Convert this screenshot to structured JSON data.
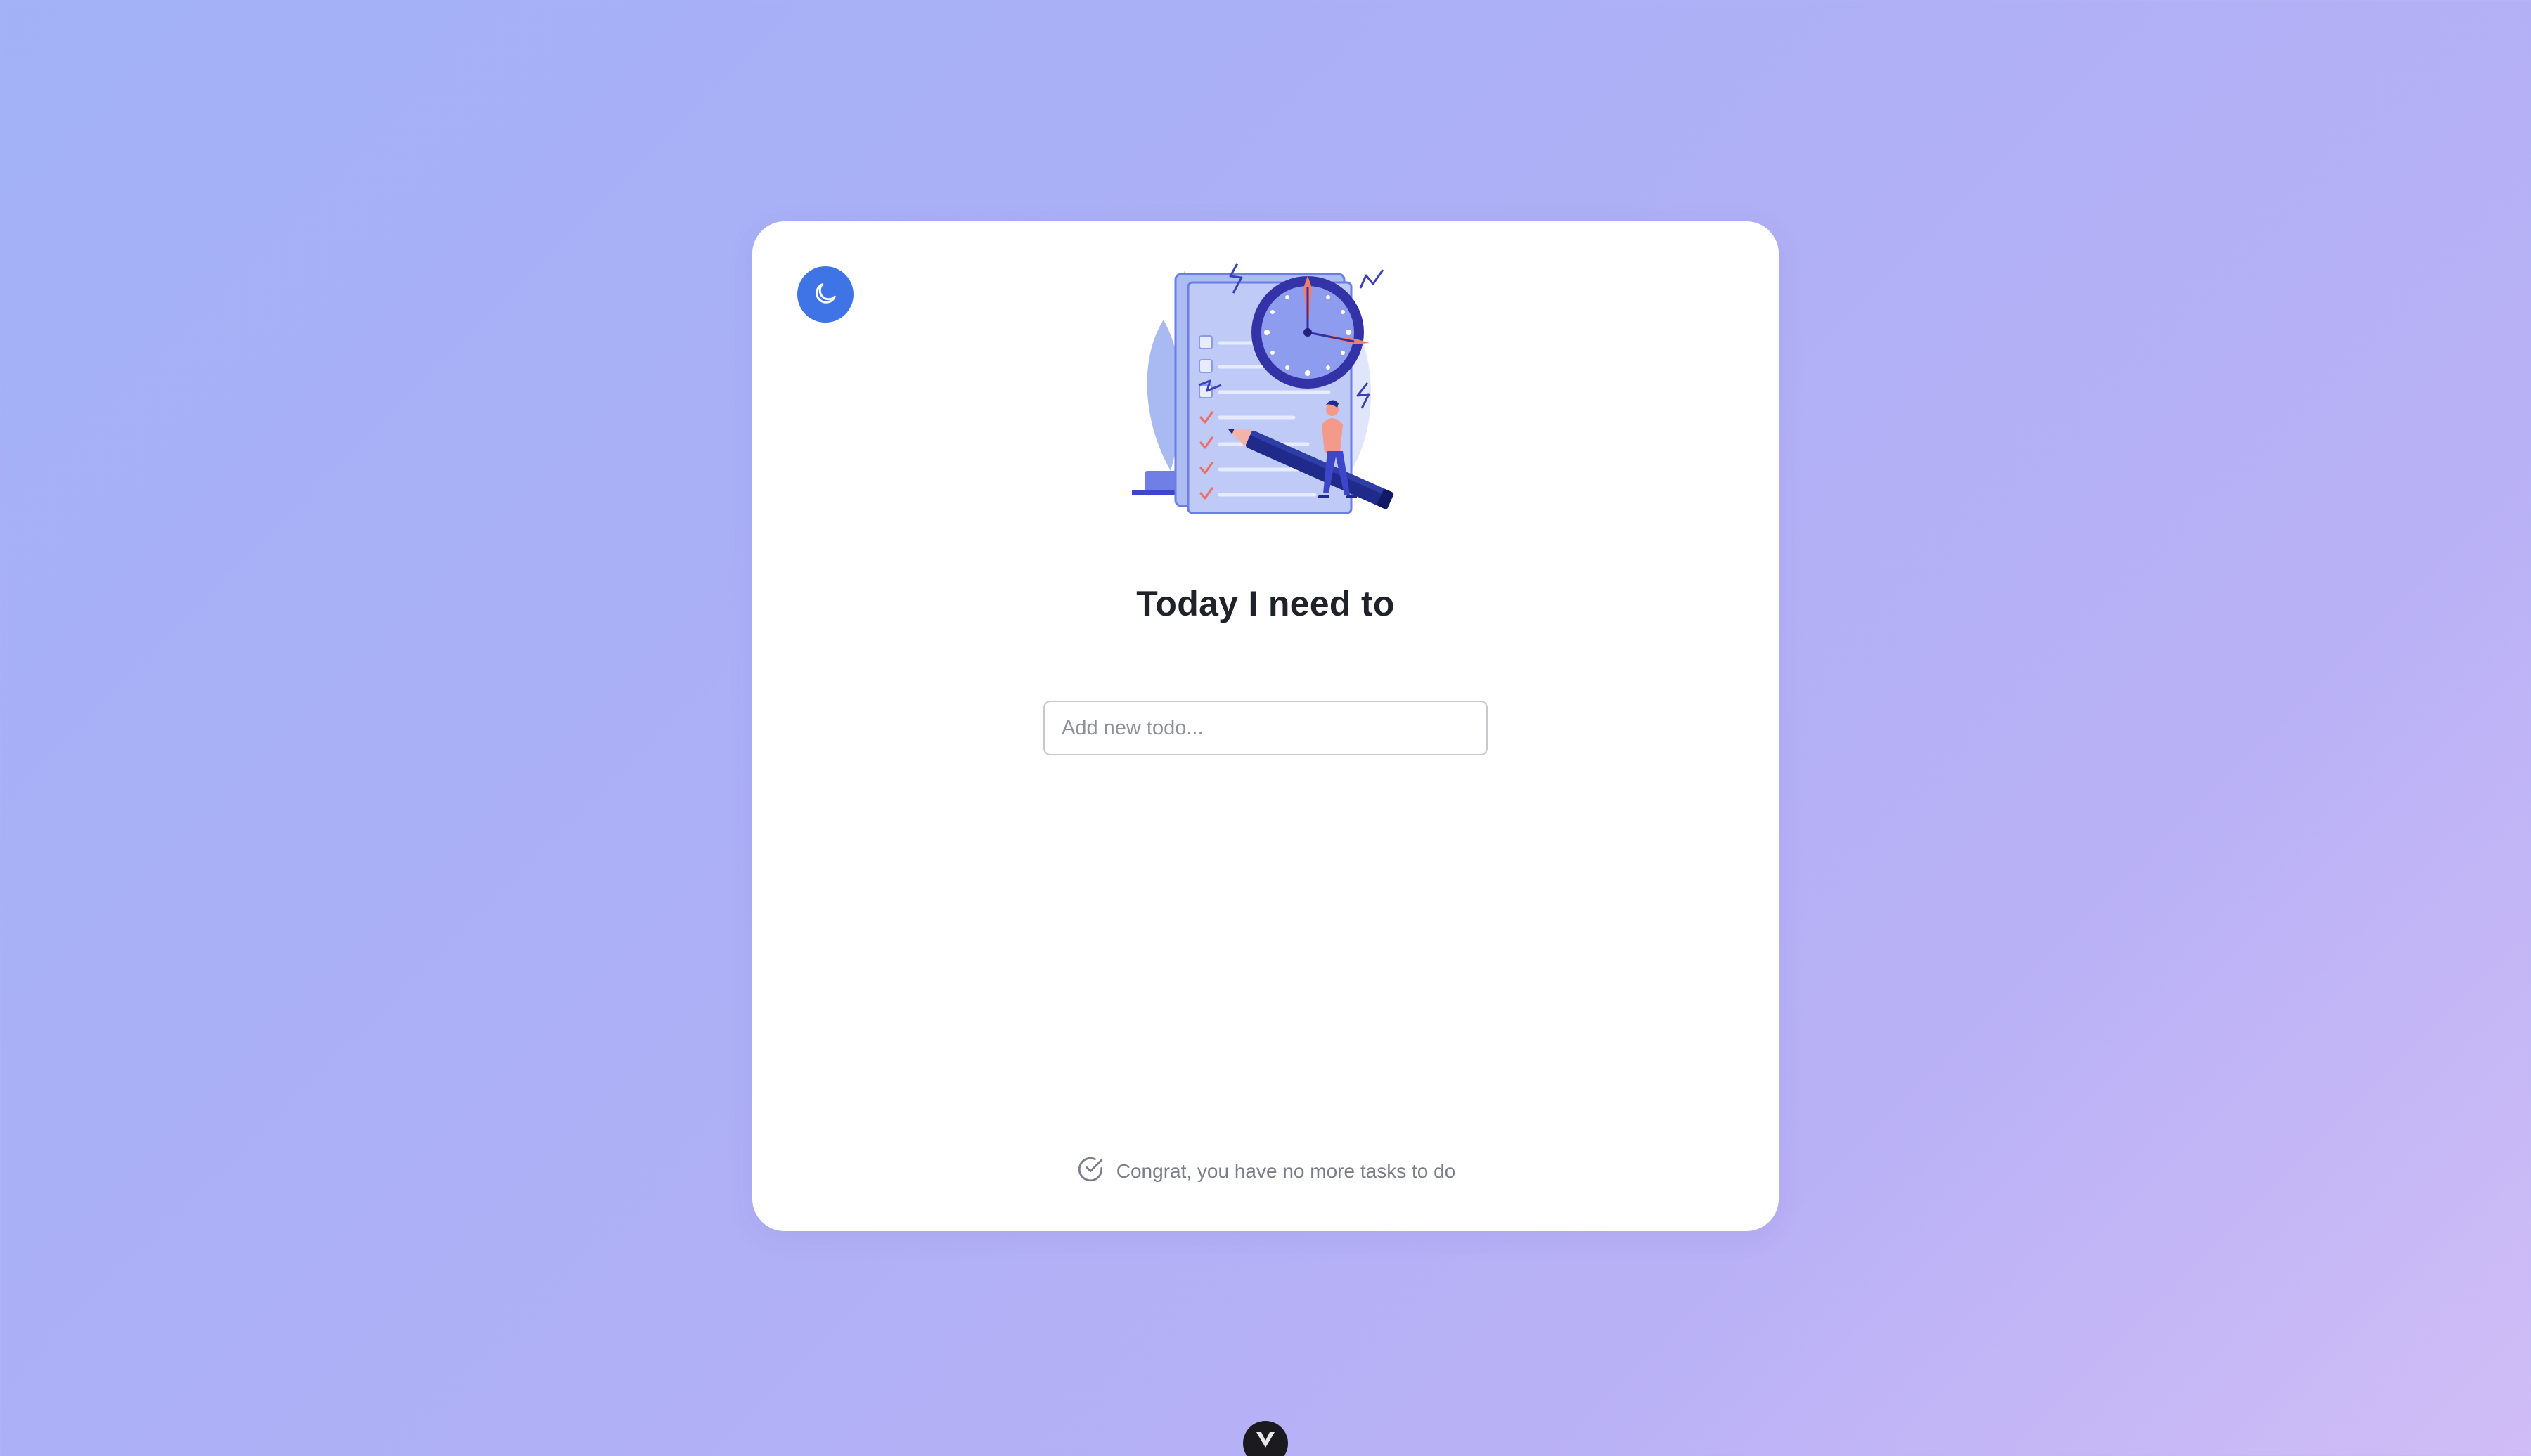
{
  "header": {
    "title": "Today I need to"
  },
  "theme_toggle": {
    "icon": "moon-icon",
    "color": "#3f74e6"
  },
  "illustration": {
    "icon": "todo-clock-illustration"
  },
  "new_todo": {
    "value": "",
    "placeholder": "Add new todo..."
  },
  "empty_state": {
    "icon": "check-circle-icon",
    "message": "Congrat, you have no more tasks to do"
  },
  "devtools_badge": {
    "icon": "vite-logo-icon"
  },
  "colors": {
    "background_start": "#a2b1f6",
    "background_end": "#d0bdf6",
    "card": "#ffffff",
    "accent": "#3f74e6",
    "title": "#1f2329",
    "muted_text": "#7b7e86"
  }
}
